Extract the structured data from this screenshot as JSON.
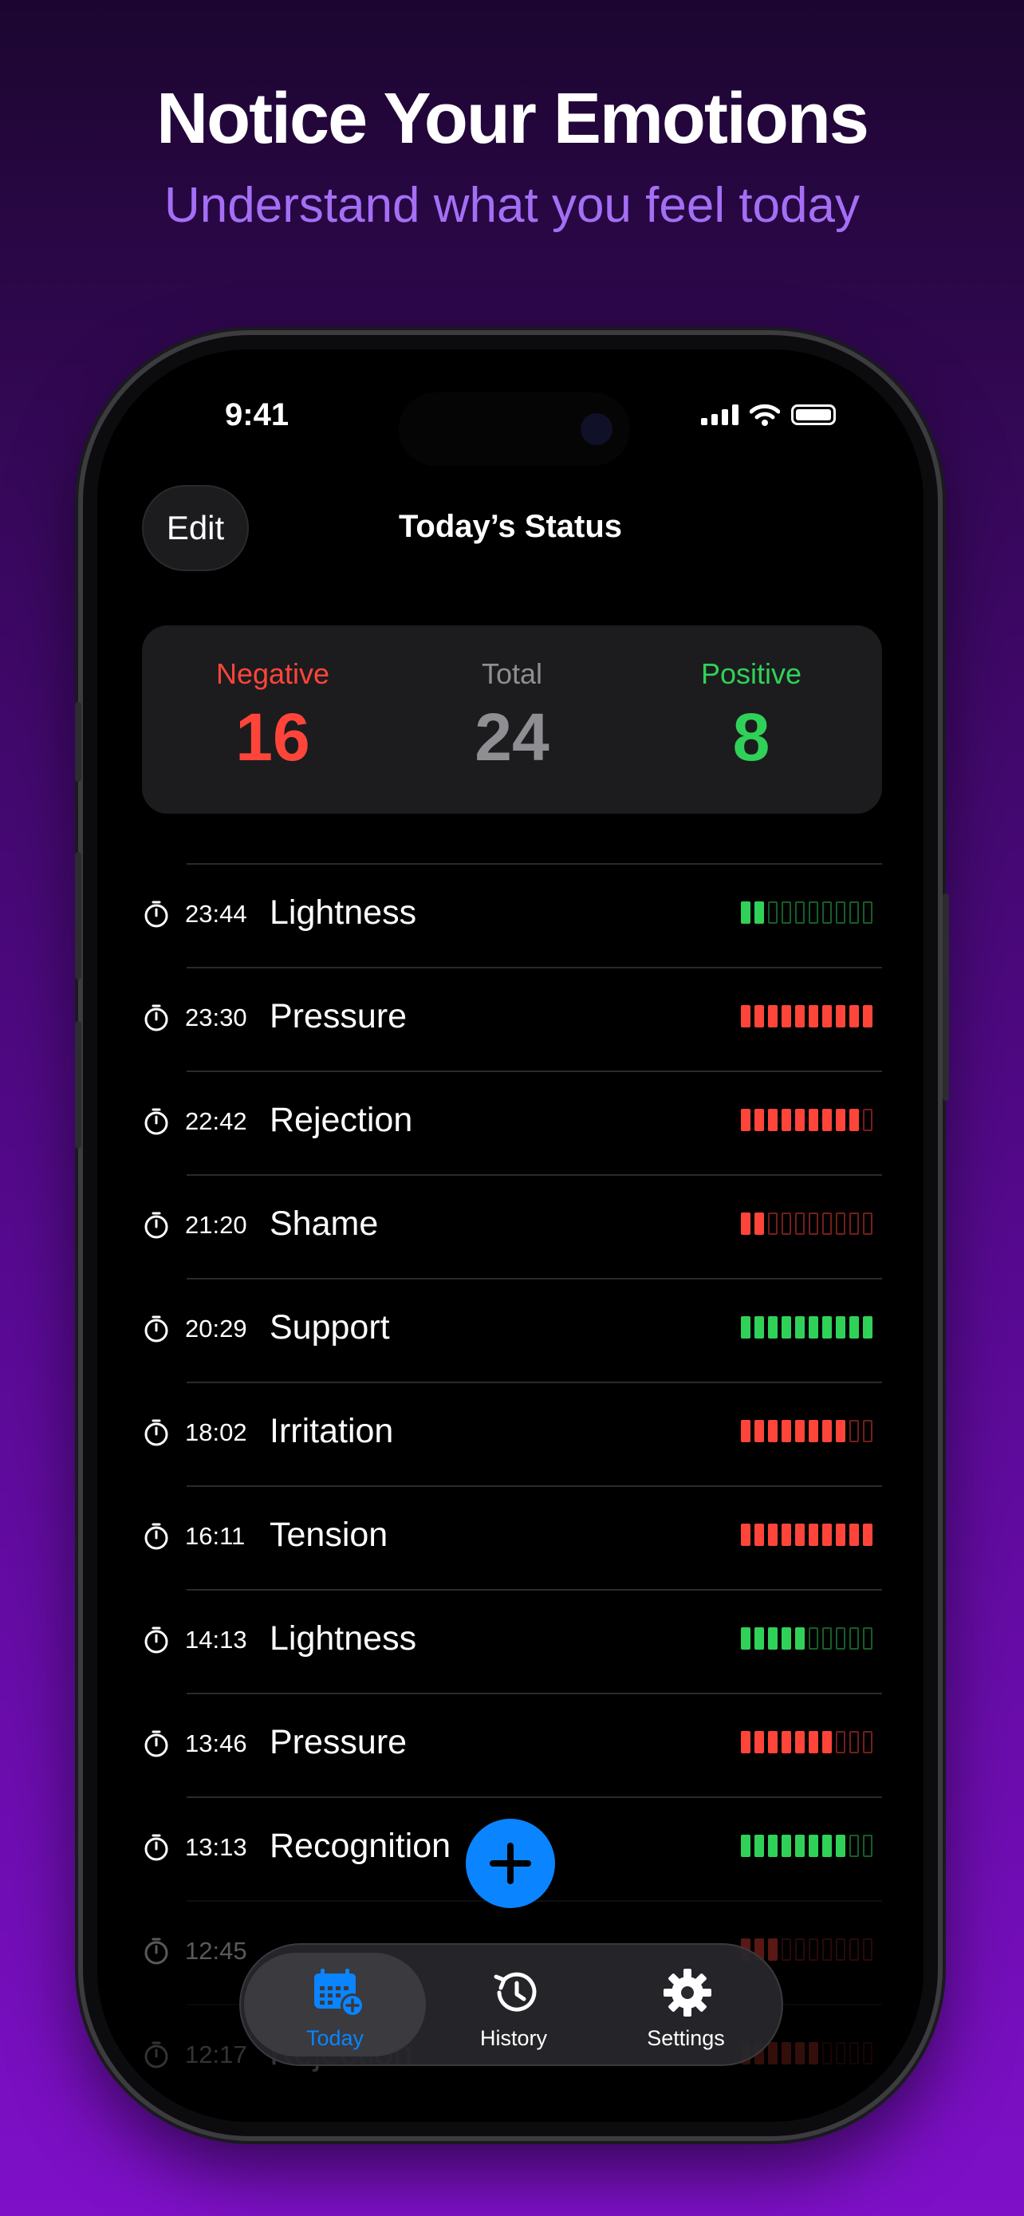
{
  "promo": {
    "headline": "Notice Your Emotions",
    "subline": "Understand what you feel today"
  },
  "status_bar": {
    "time": "9:41"
  },
  "nav": {
    "edit_label": "Edit",
    "title": "Today’s Status"
  },
  "summary": {
    "negative_label": "Negative",
    "negative_value": "16",
    "total_label": "Total",
    "total_value": "24",
    "positive_label": "Positive",
    "positive_value": "8"
  },
  "colors": {
    "negative": "#ff453a",
    "positive": "#30d158",
    "accent": "#0a84ff",
    "neutral": "#8e8e93"
  },
  "entries": [
    {
      "time": "23:44",
      "emotion": "Lightness",
      "valence": "positive",
      "intensity": 2
    },
    {
      "time": "23:30",
      "emotion": "Pressure",
      "valence": "negative",
      "intensity": 10
    },
    {
      "time": "22:42",
      "emotion": "Rejection",
      "valence": "negative",
      "intensity": 9
    },
    {
      "time": "21:20",
      "emotion": "Shame",
      "valence": "negative",
      "intensity": 2
    },
    {
      "time": "20:29",
      "emotion": "Support",
      "valence": "positive",
      "intensity": 10
    },
    {
      "time": "18:02",
      "emotion": "Irritation",
      "valence": "negative",
      "intensity": 8
    },
    {
      "time": "16:11",
      "emotion": "Tension",
      "valence": "negative",
      "intensity": 10
    },
    {
      "time": "14:13",
      "emotion": "Lightness",
      "valence": "positive",
      "intensity": 5
    },
    {
      "time": "13:46",
      "emotion": "Pressure",
      "valence": "negative",
      "intensity": 7
    },
    {
      "time": "13:13",
      "emotion": "Recognition",
      "valence": "positive",
      "intensity": 8
    },
    {
      "time": "12:45",
      "emotion": "",
      "valence": "negative",
      "intensity": 3
    },
    {
      "time": "12:17",
      "emotion": "Rejection",
      "valence": "negative",
      "intensity": 6
    }
  ],
  "max_intensity": 10,
  "fab": {
    "icon": "plus-icon",
    "label": "+"
  },
  "tabs": [
    {
      "label": "Today",
      "icon": "calendar-add-icon",
      "active": true
    },
    {
      "label": "History",
      "icon": "history-clock-icon",
      "active": false
    },
    {
      "label": "Settings",
      "icon": "gear-icon",
      "active": false
    }
  ]
}
